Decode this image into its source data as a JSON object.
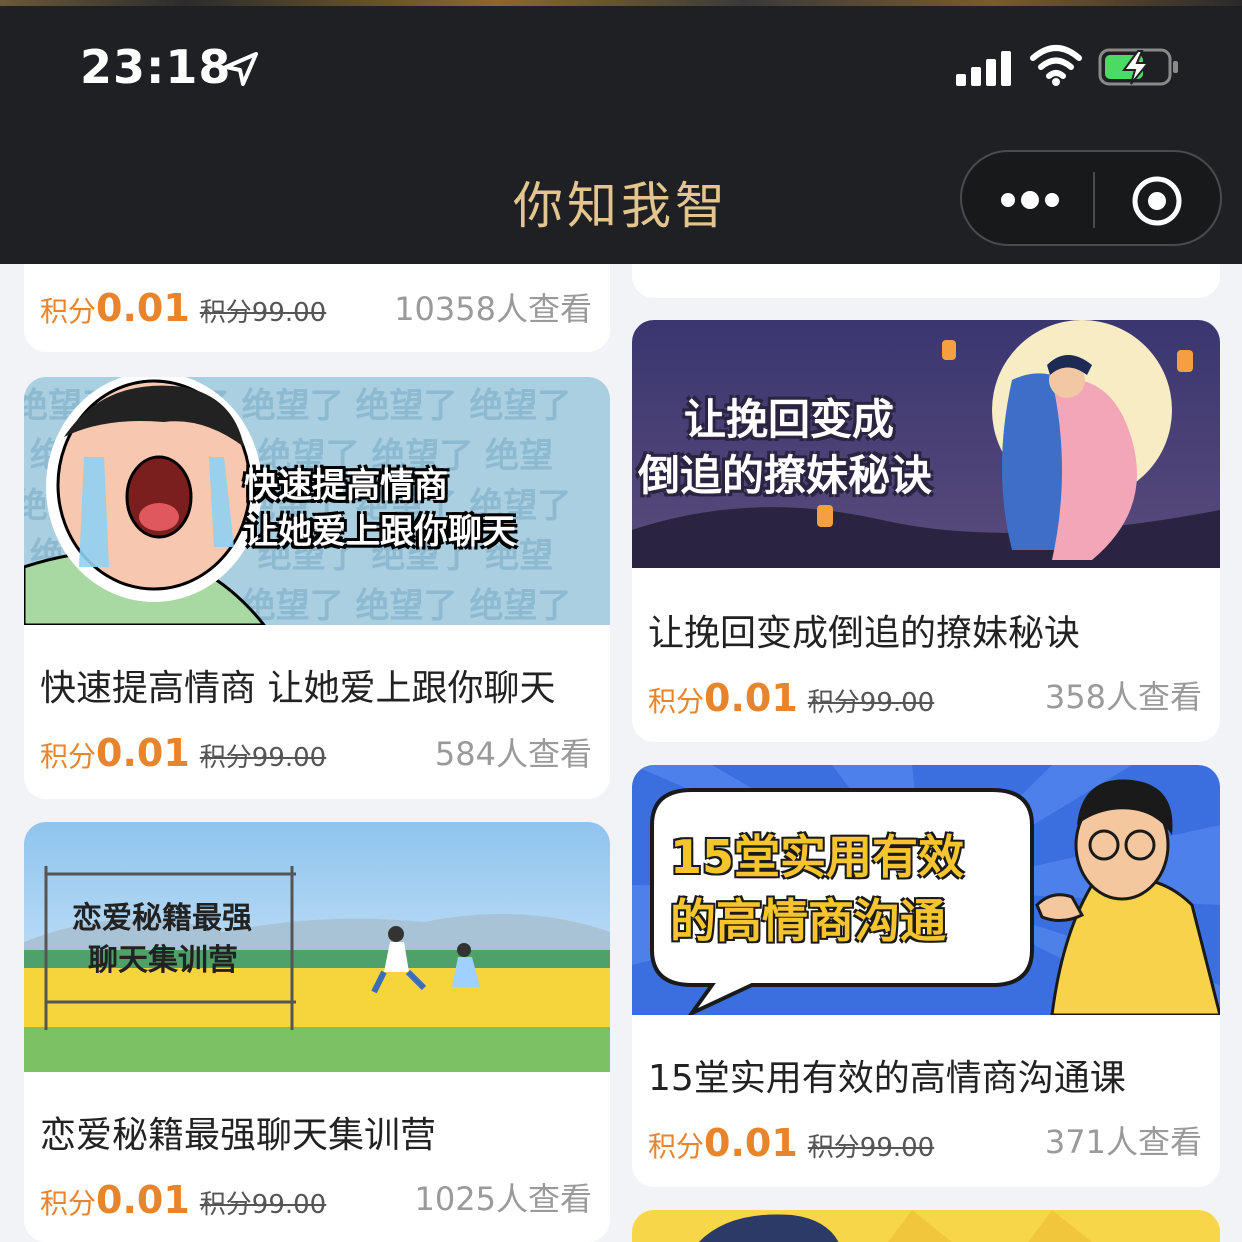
{
  "status_bar": {
    "time": "23:18"
  },
  "nav": {
    "title": "你知我智"
  },
  "cards": [
    {
      "title": "",
      "points_label": "积分",
      "points_value": "0.01",
      "original_price": "积分99.00",
      "views": "10358人查看"
    },
    {
      "title": "",
      "points_label": "",
      "points_value": "",
      "original_price": "",
      "views": ""
    },
    {
      "title": "快速提高情商 让她爱上跟你聊天",
      "points_label": "积分",
      "points_value": "0.01",
      "original_price": "积分99.00",
      "views": "584人查看",
      "banner_lines": [
        "快速提高情商",
        "让她爱上跟你聊天"
      ],
      "banner_bg_text": "绝望了 绝望了 绝望了 绝望了"
    },
    {
      "title": "让挽回变成倒追的撩妹秘诀",
      "points_label": "积分",
      "points_value": "0.01",
      "original_price": "积分99.00",
      "views": "358人查看",
      "banner_lines": [
        "让挽回变成",
        "倒追的撩妹秘诀"
      ]
    },
    {
      "title": "恋爱秘籍最强聊天集训营",
      "points_label": "积分",
      "points_value": "0.01",
      "original_price": "积分99.00",
      "views": "1025人查看",
      "banner_lines": [
        "恋爱秘籍最强",
        "聊天集训营"
      ]
    },
    {
      "title": "15堂实用有效的高情商沟通课",
      "points_label": "积分",
      "points_value": "0.01",
      "original_price": "积分99.00",
      "views": "371人查看",
      "banner_lines": [
        "15堂实用有效",
        "的高情商沟通"
      ]
    }
  ],
  "colors": {
    "header_bg": "#1f2023",
    "title_gold": "#e5c58f",
    "price_orange": "#e8852c",
    "page_bg": "#f2f3f6"
  }
}
